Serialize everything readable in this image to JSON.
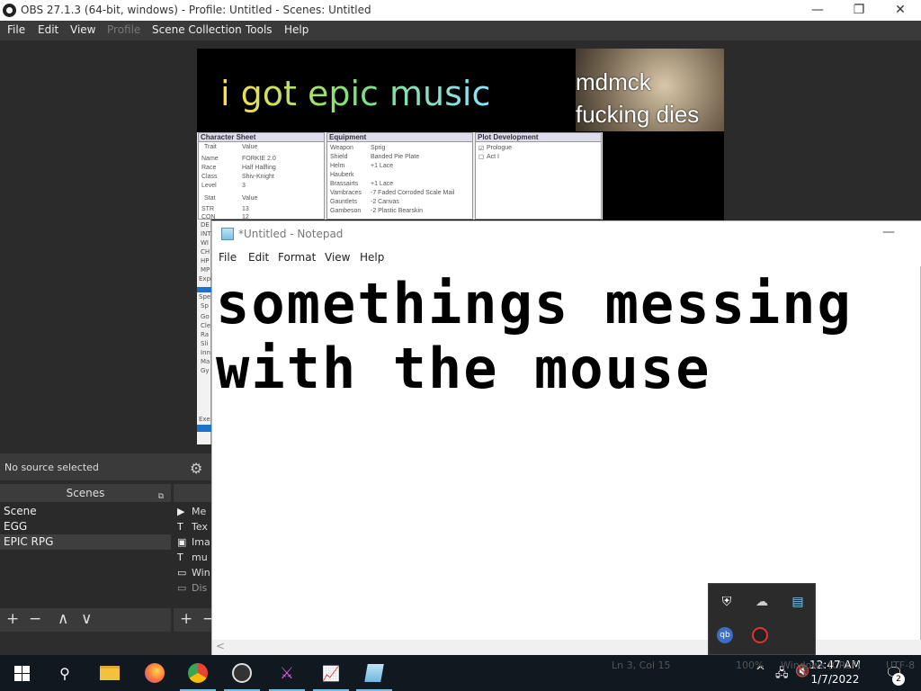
{
  "obs": {
    "title": "OBS 27.1.3 (64-bit, windows) - Profile: Untitled - Scenes: Untitled",
    "window_controls": {
      "minimize": "—",
      "maximize": "❐",
      "close": "✕"
    },
    "menu": [
      "File",
      "Edit",
      "View",
      "Profile",
      "Scene Collection",
      "Tools",
      "Help"
    ],
    "preview": {
      "epic_text": "i got epic music",
      "webcam_line1": "mdmck",
      "webcam_line2": "fucking dies",
      "sheet": {
        "character_title": "Character Sheet",
        "trait_col": "Trait",
        "value_col": "Value",
        "traits": [
          [
            "Name",
            "FORKIE 2.0"
          ],
          [
            "Race",
            "Half Halfling"
          ],
          [
            "Class",
            "Shiv-Knight"
          ],
          [
            "Level",
            "3"
          ]
        ],
        "stat_col": "Stat",
        "stat_value_col": "Value",
        "stats": [
          [
            "STR",
            "13"
          ],
          [
            "CON",
            "12"
          ]
        ],
        "equipment_title": "Equipment",
        "equipment": [
          [
            "Weapon",
            "Sprig"
          ],
          [
            "Shield",
            "Banded Pie Plate"
          ],
          [
            "Helm",
            "+1 Lace"
          ],
          [
            "Hauberk",
            ""
          ],
          [
            "Brassairts",
            "+1 Lace"
          ],
          [
            "Vambraces",
            "-7 Faded Corroded Scale Mail"
          ],
          [
            "Gauntlets",
            "-2 Canvas"
          ],
          [
            "Gambeson",
            "-2 Plastic Bearskin"
          ]
        ],
        "plot_title": "Plot Development",
        "plot": [
          {
            "label": "Prologue",
            "checked": true
          },
          {
            "label": "Act I",
            "checked": false
          }
        ],
        "left_cut": [
          "DE",
          "INT",
          "WI",
          "CH",
          "HP",
          "MP",
          "Expe",
          "Spe",
          "Sp",
          "Go",
          "Cle",
          "Ra",
          "Sli",
          "Inn",
          "Ma",
          "Gy",
          "Exe"
        ]
      }
    },
    "no_source": "No source selected",
    "scenes_header": "Scenes",
    "scenes": [
      "Scene",
      "EGG",
      "EPIC RPG"
    ],
    "selected_scene": "EPIC RPG",
    "sources": [
      {
        "icon": "▶",
        "name": "Me"
      },
      {
        "icon": "T",
        "name": "Tex"
      },
      {
        "icon": "▣",
        "name": "Ima"
      },
      {
        "icon": "T",
        "name": "mu"
      },
      {
        "icon": "▭",
        "name": "Win"
      },
      {
        "icon": "▭",
        "name": "Dis"
      }
    ],
    "tool_buttons": {
      "add": "+",
      "remove": "−",
      "up": "∧",
      "down": "∨"
    }
  },
  "notepad": {
    "title": "*Untitled - Notepad",
    "minimize": "—",
    "menu": [
      "File",
      "Edit",
      "Format",
      "View",
      "Help"
    ],
    "content": "somethings messing\nwith the mouse",
    "status_behind": {
      "position": "Ln 3, Col 15",
      "zoom": "100%",
      "eol": "Windows (CRLF)",
      "encoding": "UTF-8"
    },
    "scroll_left": "<"
  },
  "taskbar": {
    "time": "12:47 AM",
    "date": "1/7/2022",
    "notification_count": "2",
    "tray_chevron": "^",
    "accent": "#76b9ed"
  },
  "tray_popup_icons": [
    "security-shield-icon",
    "cloud-offline-icon",
    "storage-icon",
    "qbittorrent-icon",
    "obs-tray-icon"
  ]
}
